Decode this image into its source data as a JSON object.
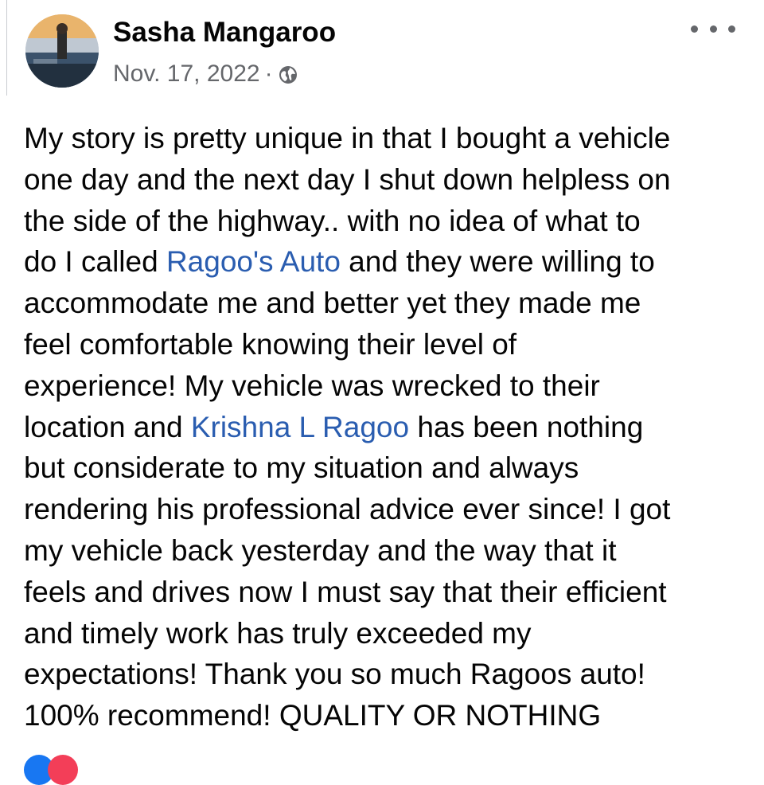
{
  "post": {
    "author": "Sasha Mangaroo",
    "date": "Nov. 17, 2022",
    "separator": "·",
    "visibility_icon": "globe-icon",
    "more_icon": "more-options-icon",
    "text_segments": [
      {
        "type": "text",
        "value": "My story is pretty unique in that I bought a vehicle\none day and the next day I shut down helpless on\nthe side of the highway.. with no idea of what to\ndo I called "
      },
      {
        "type": "mention",
        "value": "Ragoo's Auto"
      },
      {
        "type": "text",
        "value": "  and they were willing to\naccommodate me and better yet they made me\nfeel comfortable knowing their level of\nexperience! My vehicle was wrecked to their\nlocation and "
      },
      {
        "type": "mention",
        "value": "Krishna L Ragoo"
      },
      {
        "type": "text",
        "value": "  has been nothing\nbut considerate to my situation and always\nrendering his professional advice ever since! I  got\nmy vehicle back yesterday and the way that it\nfeels and drives now I must say that their efficient\nand timely work has truly exceeded my\nexpectations! Thank you so much Ragoos auto!\n100% recommend! QUALITY OR NOTHING"
      }
    ],
    "reactions": [
      "like-icon",
      "love-icon"
    ]
  },
  "colors": {
    "mention": "#2a5db0",
    "meta": "#65676b",
    "text": "#050505"
  }
}
